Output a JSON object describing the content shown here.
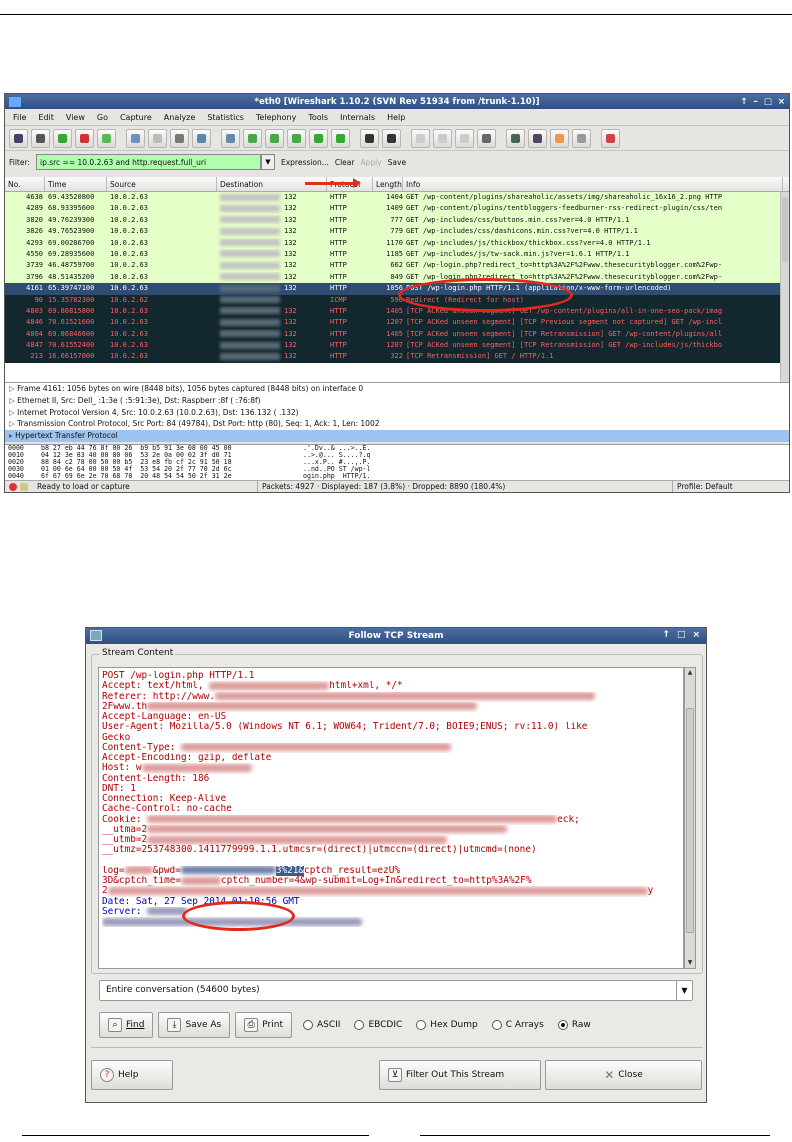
{
  "wireshark": {
    "title": "*eth0   [Wireshark 1.10.2  (SVN Rev 51934 from /trunk-1.10)]",
    "window_controls": [
      "↑",
      "–",
      "□",
      "×"
    ],
    "menu": [
      "File",
      "Edit",
      "View",
      "Go",
      "Capture",
      "Analyze",
      "Statistics",
      "Telephony",
      "Tools",
      "Internals",
      "Help"
    ],
    "filter": {
      "label": "Filter:",
      "value": "ip.src == 10.0.2.63 and http.request.full_uri",
      "expression": "Expression...",
      "clear": "Clear",
      "apply": "Apply",
      "save": "Save"
    },
    "columns": [
      "No.",
      "Time",
      "Source",
      "Destination",
      "Protocol",
      "Length",
      "Info"
    ],
    "rows": [
      {
        "no": "4638",
        "time": "69.43520800",
        "src": "10.0.2.63",
        "dst": "132",
        "proto": "HTTP",
        "len": "1404",
        "info": "GET /wp-content/plugins/shareaholic/assets/img/shareaholic_16x16_2.png HTTP"
      },
      {
        "no": "4289",
        "time": "68.93395600",
        "src": "10.0.2.63",
        "dst": "132",
        "proto": "HTTP",
        "len": "1409",
        "info": "GET /wp-content/plugins/tentbloggers-feedburner-rss-redirect-plugin/css/ten"
      },
      {
        "no": "3820",
        "time": "49.76239300",
        "src": "10.0.2.63",
        "dst": "132",
        "proto": "HTTP",
        "len": "777",
        "info": "GET /wp-includes/css/buttons.min.css?ver=4.0 HTTP/1.1"
      },
      {
        "no": "3826",
        "time": "49.76523900",
        "src": "10.0.2.63",
        "dst": "132",
        "proto": "HTTP",
        "len": "779",
        "info": "GET /wp-includes/css/dashicons.min.css?ver=4.0 HTTP/1.1"
      },
      {
        "no": "4293",
        "time": "69.00286700",
        "src": "10.0.2.63",
        "dst": "132",
        "proto": "HTTP",
        "len": "1170",
        "info": "GET /wp-includes/js/thickbox/thickbox.css?ver=4.0 HTTP/1.1"
      },
      {
        "no": "4550",
        "time": "69.28935600",
        "src": "10.0.2.63",
        "dst": "132",
        "proto": "HTTP",
        "len": "1185",
        "info": "GET /wp-includes/js/tw-sack.min.js?ver=1.6.1 HTTP/1.1"
      },
      {
        "no": "3739",
        "time": "46.48759700",
        "src": "10.0.2.63",
        "dst": "132",
        "proto": "HTTP",
        "len": "662",
        "info": "GET /wp-login.php?redirect_to=http%3A%2F%2Fwww.thesecurityblogger.com%2Fwp-"
      },
      {
        "no": "3796",
        "time": "48.51435200",
        "src": "10.0.2.63",
        "dst": "132",
        "proto": "HTTP",
        "len": "849",
        "info": "GET /wp-login.php?redirect_to=http%3A%2F%2Fwww.thesecurityblogger.com%2Fwp-"
      },
      {
        "no": "4161",
        "time": "65.39747100",
        "src": "10.0.2.63",
        "dst": "132",
        "proto": "HTTP",
        "len": "1056",
        "info": "POST /wp-login.php HTTP/1.1  (application/x-www-form-urlencoded)"
      },
      {
        "no": "90",
        "time": "15.35782300",
        "src": "10.0.2.62",
        "dst": "",
        "proto": "ICMP",
        "len": "590",
        "info": "Redirect             (Redirect for host)"
      },
      {
        "no": "4803",
        "time": "69.86815800",
        "src": "10.0.2.63",
        "dst": "132",
        "proto": "HTTP",
        "len": "1405",
        "info": "[TCP ACKed unseen segment] GET /wp-content/plugins/all-in-one-seo-pack/imag"
      },
      {
        "no": "4846",
        "time": "70.61521600",
        "src": "10.0.2.63",
        "dst": "132",
        "proto": "HTTP",
        "len": "1207",
        "info": "[TCP ACKed unseen segment] [TCP Previous segment not captured] GET /wp-incl"
      },
      {
        "no": "4804",
        "time": "69.86846600",
        "src": "10.0.2.63",
        "dst": "132",
        "proto": "HTTP",
        "len": "1405",
        "info": "[TCP ACKed unseen segment] [TCP Retransmission] GET /wp-content/plugins/all"
      },
      {
        "no": "4847",
        "time": "70.61552400",
        "src": "10.0.2.63",
        "dst": "132",
        "proto": "HTTP",
        "len": "1207",
        "info": "[TCP ACKed unseen segment] [TCP Retransmission] GET /wp-includes/js/thickbo"
      },
      {
        "no": "213",
        "time": "16.66157000",
        "src": "10.0.2.63",
        "dst": "132",
        "proto": "HTTP",
        "len": "322",
        "info": "[TCP Retransmission] GET / HTTP/1.1"
      }
    ],
    "details": [
      "Frame 4161: 1056 bytes on wire (8448 bits), 1056 bytes captured (8448 bits) on interface 0",
      "Ethernet II, Src: Dell_    :1:3e (  :5:91:3e), Dst: Raspberr    :8f (        :76:8f)",
      "Internet Protocol Version 4, Src: 10.0.2.63 (10.0.2.63), Dst:       136.132 (          .132)",
      "Transmission Control Protocol, Src Port:     84 (49784), Dst Port: http (80), Seq: 1, Ack: 1, Len: 1002",
      "Hypertext Transfer Protocol"
    ],
    "hex": [
      {
        "off": "0000",
        "bytes": "b8 27 eb 44 76 8f 00 26  b9 b5 91 3e 08 00 45 00",
        "ascii": ".'.Dv..& ...>..E."
      },
      {
        "off": "0010",
        "bytes": "04 12 3e 83 40 00 80 06  53 2e 0a 00 02 3f d0 71",
        "ascii": "..>.@... S....?.q"
      },
      {
        "off": "0020",
        "bytes": "88 84 c2 78 00 50 00 b5  23 e8 fb cf 2c 91 50 18",
        "ascii": "...x.P.. #...,.P."
      },
      {
        "off": "0030",
        "bytes": "01 00 6e 64 00 00 50 4f  53 54 20 2f 77 70 2d 6c",
        "ascii": "..nd..PO ST /wp-l"
      },
      {
        "off": "0040",
        "bytes": "6f 67 69 6e 2e 70 68 70  20 48 54 54 50 2f 31 2e",
        "ascii": "ogin.php  HTTP/1."
      }
    ],
    "status": {
      "ready": "Ready to load or capture",
      "packets": "Packets: 4927 · Displayed: 187 (3.8%) · Dropped: 8890 (180.4%)",
      "profile": "Profile: Default"
    }
  },
  "tcp": {
    "title": "Follow TCP Stream",
    "window_controls": [
      "↑",
      "□",
      "×"
    ],
    "group_label": "Stream Content",
    "lines": [
      {
        "t": "POST /wp-login.php HTTP/1.1",
        "c": "req"
      },
      {
        "t": "Accept: text/html, ",
        "b": 120,
        "t2": "html+xml, */*",
        "c": "req"
      },
      {
        "t": "Referer: http://www.",
        "b": 380,
        "c": "req"
      },
      {
        "t": "2Fwww.th",
        "b": 330,
        "c": "req"
      },
      {
        "t": "Accept-Language: en-US",
        "c": "req"
      },
      {
        "t": "User-Agent: Mozilla/5.0 (Windows NT 6.1; WOW64; Trident/7.0; BOIE9;ENUS; rv:11.0) like",
        "c": "req"
      },
      {
        "t": "Gecko",
        "c": "req"
      },
      {
        "t": "Content-Type: ",
        "b": 270,
        "c": "req"
      },
      {
        "t": "Accept-Encoding: gzip, deflate",
        "c": "req"
      },
      {
        "t": "Host: w",
        "b": 110,
        "c": "req"
      },
      {
        "t": "Content-Length: 186",
        "c": "req"
      },
      {
        "t": "DNT: 1",
        "c": "req"
      },
      {
        "t": "Connection: Keep-Alive",
        "c": "req"
      },
      {
        "t": "Cache-Control: no-cache",
        "c": "req"
      },
      {
        "t": "Cookie: ",
        "b": 410,
        "t2": "eck;",
        "c": "req"
      },
      {
        "t": "__utma=2",
        "b": 360,
        "c": "req"
      },
      {
        "t": "__utmb=2",
        "b": 300,
        "c": "req"
      },
      {
        "t": "__utmz=253748300.1411779999.1.1.utmcsr=(direct)|utmccn=(direct)|utmcmd=(none)",
        "c": "req"
      },
      {
        "t": "",
        "c": "req"
      },
      {
        "t": "log=",
        "b": 28,
        "t2": "&pwd=",
        "hl": "3%21&",
        "t3": "cptch_result=ezU%",
        "c": "req"
      },
      {
        "t": "3D&cptch_time=",
        "b": 40,
        "t2": "cptch_number=4&wp-submit=Log+In&redirect_to=http%3A%2F%",
        "c": "req"
      },
      {
        "t": "2",
        "b": 540,
        "t2": "y",
        "c": "req"
      },
      {
        "t": "Date: Sat, 27 Sep 2014 01:10:56 GMT",
        "c": "resp"
      },
      {
        "t": "Server: ",
        "b": 40,
        "c": "resp"
      },
      {
        "t": "",
        "b": 260,
        "c": "resp"
      }
    ],
    "select": "Entire conversation (54600 bytes)",
    "buttons": {
      "find": "Find",
      "save_as": "Save As",
      "print": "Print"
    },
    "radios": [
      "ASCII",
      "EBCDIC",
      "Hex Dump",
      "C Arrays",
      "Raw"
    ],
    "selected_radio": "Raw",
    "help": "Help",
    "filter_out": "Filter Out This Stream",
    "close": "Close"
  },
  "colors": {
    "http_row": "#e4ffc7",
    "selected_row": "#2f4c72",
    "icmp_row": "#12272e",
    "tcp_bad_row": "#12272e",
    "red_text": "#ff5f5f",
    "annotation": "#e02a1a"
  }
}
